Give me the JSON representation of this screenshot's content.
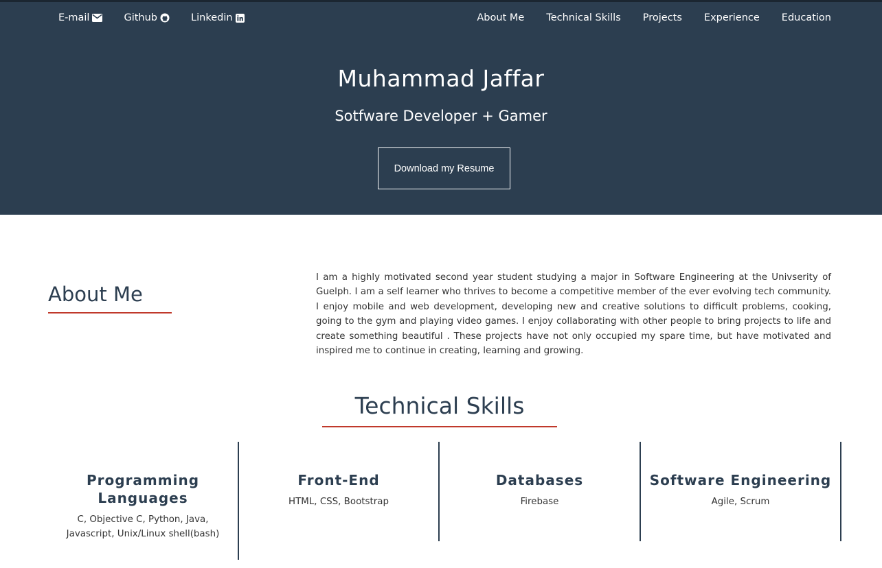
{
  "nav": {
    "left": [
      {
        "label": "E-mail",
        "icon": "envelope-icon"
      },
      {
        "label": "Github",
        "icon": "github-icon"
      },
      {
        "label": "Linkedin",
        "icon": "linkedin-icon"
      }
    ],
    "right": [
      "About Me",
      "Technical Skills",
      "Projects",
      "Experience",
      "Education"
    ]
  },
  "hero": {
    "name": "Muhammad Jaffar",
    "tagline": "Sotfware Developer + Gamer",
    "resume_button": "Download my Resume"
  },
  "about": {
    "heading": "About Me",
    "text": "I am a highly motivated second year student studying a major in Software Engineering at the Univserity of Guelph. I am a self learner who thrives to become a competitive member of the ever evolving tech community. I enjoy mobile and web development, developing new and creative solutions to difficult problems, cooking, going to the gym and playing video games. I enjoy collaborating with other people to bring projects to life and create something beautiful . These projects have not only occupied my spare time, but have motivated and inspired me to continue in creating, learning and growing."
  },
  "skills": {
    "heading": "Technical Skills",
    "columns": [
      {
        "title": "Programming Languages",
        "items": "C, Objective C, Python, Java, Javascript, Unix/Linux shell(bash)"
      },
      {
        "title": "Front-End",
        "items": "HTML, CSS, Bootstrap"
      },
      {
        "title": "Databases",
        "items": "Firebase"
      },
      {
        "title": "Software Engineering",
        "items": "Agile, Scrum"
      }
    ]
  },
  "colors": {
    "hero_bg": "#2c3e50",
    "accent": "#c0392b",
    "heading": "#2c3e50"
  }
}
